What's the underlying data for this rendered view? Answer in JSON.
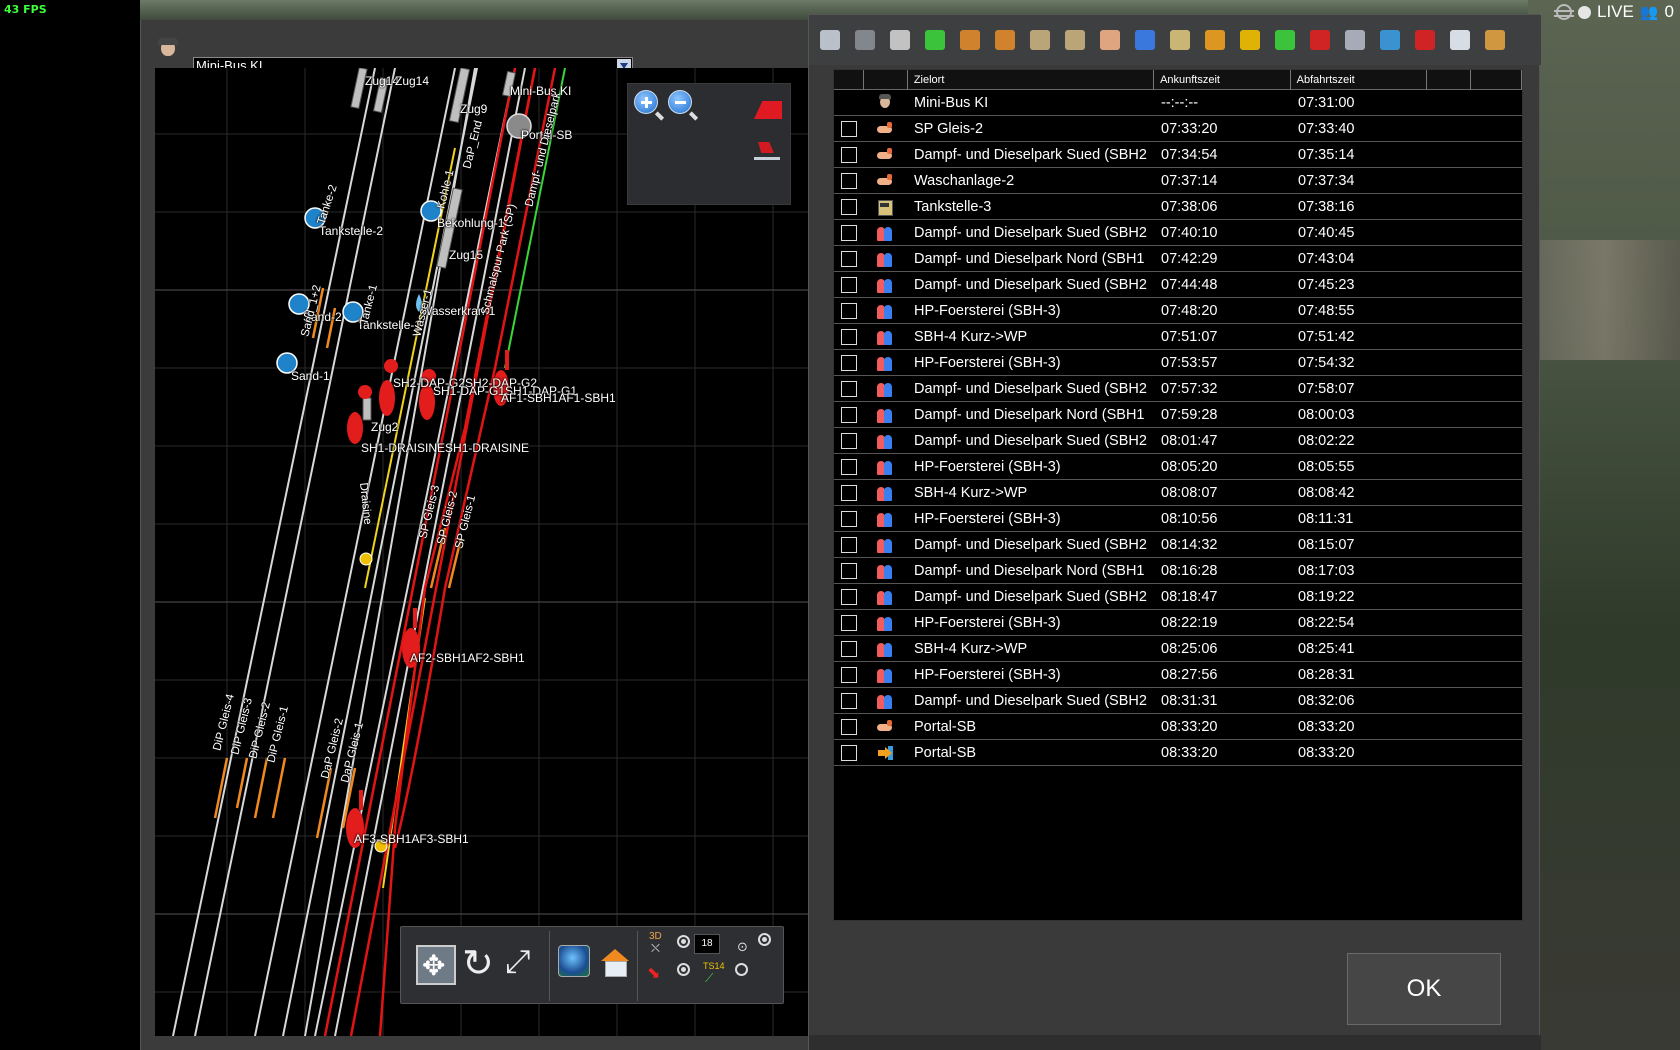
{
  "status": {
    "fps": "43 FPS",
    "live": "LIVE",
    "players": "0"
  },
  "vehicle_select": {
    "value": "Mini-Bus KI"
  },
  "map": {
    "labels": {
      "zug14": "Zug14",
      "zug14b": "Zug14",
      "minibus": "Mini-Bus KI",
      "zug9": "Zug9",
      "portal": "Portal-SB",
      "tanke2": "Tanke-2",
      "tankstelle2": "Tankstelle-2",
      "bekohlung": "Bekohlung-1",
      "zug15": "Zug15",
      "sand2": "Sand-2",
      "tankstelle1": "Tankstelle-1",
      "wasserkran": "Wasserkran-1",
      "sand1": "Sand-1",
      "sh2dap": "SH2-DAP-G2SH2-DAP-G2",
      "sh1dap": "SH1-DAP-G1SH1-DAP-G1",
      "af1": "AF1-SBH1AF1-SBH1",
      "zug2": "Zug2",
      "sh1drais": "SH1-DRAISINESH1-DRAISINE",
      "af2": "AF2-SBH1AF2-SBH1",
      "af3": "AF3-SBH1AF3-SBH1",
      "sand12": "Sand_1+2",
      "tanke1": "Tanke-1",
      "wasser1": "Wasser-1",
      "kohle1": "Kohle-1",
      "dapende": "DaP_End",
      "schmalspur": "Schmalspur Park (SP)",
      "dampfpark": "Dampf- und Dieselpark",
      "draisine": "Draisine",
      "spg3": "SP Gleis-3",
      "spg2": "SP Gleis-2",
      "spg1": "SP Gleis-1",
      "dipg4": "DiP Gleis-4",
      "dipg3": "DiP Gleis-3",
      "dipg2": "DiP Gleis-2",
      "dipg1": "DiP Gleis-1",
      "dapg2": "DaP Gleis-2",
      "dapg1": "DaP Gleis-1"
    },
    "toolbar": {
      "cam_label": "3D",
      "speed_value": "18",
      "ts_label": "TS14"
    }
  },
  "timetable": {
    "columns": {
      "zielort": "Zielort",
      "ankunft": "Ankunftszeit",
      "abfahrt": "Abfahrtszeit"
    },
    "rows": [
      {
        "icon": "driver",
        "ziel": "Mini-Bus KI",
        "ankunft": "--:--:--",
        "abfahrt": "07:31:00",
        "check": false
      },
      {
        "icon": "hand",
        "ziel": "SP Gleis-2",
        "ankunft": "07:33:20",
        "abfahrt": "07:33:40",
        "check": true
      },
      {
        "icon": "hand",
        "ziel": "Dampf- und Dieselpark Sued (SBH2",
        "ankunft": "07:34:54",
        "abfahrt": "07:35:14",
        "check": true
      },
      {
        "icon": "hand",
        "ziel": "Waschanlage-2",
        "ankunft": "07:37:14",
        "abfahrt": "07:37:34",
        "check": true
      },
      {
        "icon": "fuel",
        "ziel": "Tankstelle-3",
        "ankunft": "07:38:06",
        "abfahrt": "07:38:16",
        "check": true
      },
      {
        "icon": "people",
        "ziel": "Dampf- und Dieselpark Sued (SBH2",
        "ankunft": "07:40:10",
        "abfahrt": "07:40:45",
        "check": true
      },
      {
        "icon": "people",
        "ziel": "Dampf- und Dieselpark Nord (SBH1",
        "ankunft": "07:42:29",
        "abfahrt": "07:43:04",
        "check": true
      },
      {
        "icon": "people",
        "ziel": "Dampf- und Dieselpark Sued (SBH2",
        "ankunft": "07:44:48",
        "abfahrt": "07:45:23",
        "check": true
      },
      {
        "icon": "people",
        "ziel": "HP-Foersterei (SBH-3)",
        "ankunft": "07:48:20",
        "abfahrt": "07:48:55",
        "check": true
      },
      {
        "icon": "people",
        "ziel": "SBH-4 Kurz->WP",
        "ankunft": "07:51:07",
        "abfahrt": "07:51:42",
        "check": true
      },
      {
        "icon": "people",
        "ziel": "HP-Foersterei (SBH-3)",
        "ankunft": "07:53:57",
        "abfahrt": "07:54:32",
        "check": true
      },
      {
        "icon": "people",
        "ziel": "Dampf- und Dieselpark Sued (SBH2",
        "ankunft": "07:57:32",
        "abfahrt": "07:58:07",
        "check": true
      },
      {
        "icon": "people",
        "ziel": "Dampf- und Dieselpark Nord (SBH1",
        "ankunft": "07:59:28",
        "abfahrt": "08:00:03",
        "check": true
      },
      {
        "icon": "people",
        "ziel": "Dampf- und Dieselpark Sued (SBH2",
        "ankunft": "08:01:47",
        "abfahrt": "08:02:22",
        "check": true
      },
      {
        "icon": "people",
        "ziel": "HP-Foersterei (SBH-3)",
        "ankunft": "08:05:20",
        "abfahrt": "08:05:55",
        "check": true
      },
      {
        "icon": "people",
        "ziel": "SBH-4 Kurz->WP",
        "ankunft": "08:08:07",
        "abfahrt": "08:08:42",
        "check": true
      },
      {
        "icon": "people",
        "ziel": "HP-Foersterei (SBH-3)",
        "ankunft": "08:10:56",
        "abfahrt": "08:11:31",
        "check": true
      },
      {
        "icon": "people",
        "ziel": "Dampf- und Dieselpark Sued (SBH2",
        "ankunft": "08:14:32",
        "abfahrt": "08:15:07",
        "check": true
      },
      {
        "icon": "people",
        "ziel": "Dampf- und Dieselpark Nord (SBH1",
        "ankunft": "08:16:28",
        "abfahrt": "08:17:03",
        "check": true
      },
      {
        "icon": "people",
        "ziel": "Dampf- und Dieselpark Sued (SBH2",
        "ankunft": "08:18:47",
        "abfahrt": "08:19:22",
        "check": true
      },
      {
        "icon": "people",
        "ziel": "HP-Foersterei (SBH-3)",
        "ankunft": "08:22:19",
        "abfahrt": "08:22:54",
        "check": true
      },
      {
        "icon": "people",
        "ziel": "SBH-4 Kurz->WP",
        "ankunft": "08:25:06",
        "abfahrt": "08:25:41",
        "check": true
      },
      {
        "icon": "people",
        "ziel": "HP-Foersterei (SBH-3)",
        "ankunft": "08:27:56",
        "abfahrt": "08:28:31",
        "check": true
      },
      {
        "icon": "people",
        "ziel": "Dampf- und Dieselpark Sued (SBH2",
        "ankunft": "08:31:31",
        "abfahrt": "08:32:06",
        "check": true
      },
      {
        "icon": "hand",
        "ziel": "Portal-SB",
        "ankunft": "08:33:20",
        "abfahrt": "08:33:20",
        "check": true
      },
      {
        "icon": "portal",
        "ziel": "Portal-SB",
        "ankunft": "08:33:20",
        "abfahrt": "08:33:20",
        "check": true
      }
    ],
    "toolbar_icons": [
      "save-icon",
      "trash-icon",
      "grid-small-icon",
      "grid-green-icon",
      "move-up-icon",
      "move-down-icon",
      "move-left-icon",
      "move-right-icon",
      "hand-icon",
      "passengers-icon",
      "fuel-icon",
      "multi-grid-icon",
      "add-yellow-icon",
      "add-green-icon",
      "delete-red-icon",
      "settings-icon",
      "portal-icon",
      "flag-icon",
      "ruler-icon",
      "locomotive-icon"
    ],
    "ok_label": "OK"
  }
}
